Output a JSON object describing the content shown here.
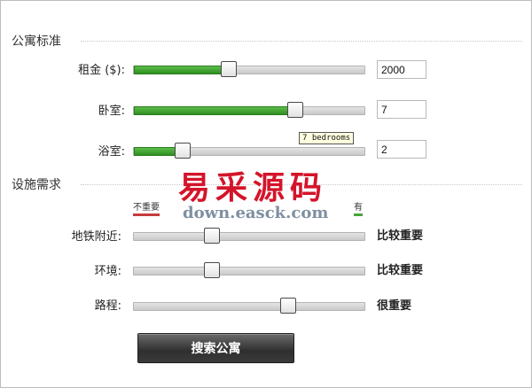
{
  "sections": {
    "apartment": {
      "title": "公寓标准"
    },
    "amenities": {
      "title": "设施需求"
    }
  },
  "criteria": [
    {
      "label": "租金 ($):",
      "value": "2000",
      "level": 0.41,
      "color": "#3a9a2c"
    },
    {
      "label": "卧室:",
      "value": "7",
      "level": 0.7,
      "color": "#3a9a2c"
    },
    {
      "label": "浴室:",
      "value": "2",
      "level": 0.21,
      "color": "#3a9a2c"
    }
  ],
  "tooltip": "7 bedrooms",
  "scale": {
    "min_label": "不重要",
    "max_label": "有",
    "min_color": "#c63b3b",
    "max_color": "#4aa43a"
  },
  "preferences": [
    {
      "label": "地铁附近:",
      "importance": "比较重要",
      "level": 0.34
    },
    {
      "label": "环境:",
      "importance": "比较重要",
      "level": 0.34
    },
    {
      "label": "路程:",
      "importance": "很重要",
      "level": 0.67
    }
  ],
  "search_button": "搜索公寓",
  "watermark": {
    "text": "易采源码",
    "url": "down.easck.com",
    "color": "#d4142a"
  }
}
